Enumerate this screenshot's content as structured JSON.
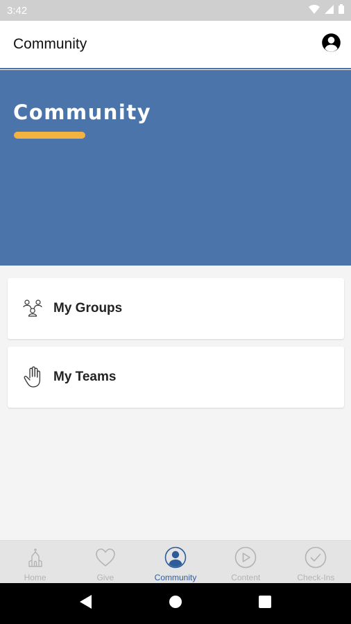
{
  "status_bar": {
    "time": "3:42",
    "icons": [
      "wifi-icon",
      "signal-icon",
      "battery-icon"
    ]
  },
  "app_bar": {
    "title": "Community",
    "profile_icon": "account-circle-icon"
  },
  "hero": {
    "title": "Community",
    "accent_color": "#f3b341",
    "background_color": "#4b74aa"
  },
  "cards": [
    {
      "label": "My Groups",
      "icon": "group-icon"
    },
    {
      "label": "My Teams",
      "icon": "raised-hand-icon"
    }
  ],
  "bottom_nav": {
    "active_index": 2,
    "active_color": "#2e5c98",
    "items": [
      {
        "label": "Home",
        "icon": "church-icon"
      },
      {
        "label": "Give",
        "icon": "heart-icon"
      },
      {
        "label": "Community",
        "icon": "person-circle-icon"
      },
      {
        "label": "Content",
        "icon": "play-circle-icon"
      },
      {
        "label": "Check-Ins",
        "icon": "check-circle-icon"
      }
    ]
  },
  "system_nav": {
    "icons": [
      "back-icon",
      "home-icon",
      "recents-icon"
    ]
  }
}
